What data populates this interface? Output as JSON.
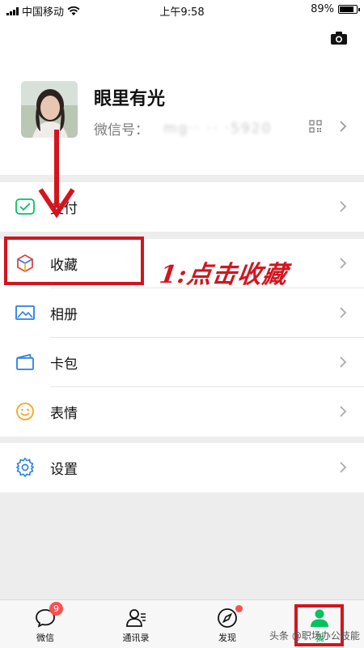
{
  "status_bar": {
    "carrier": "中国移动",
    "time": "上午9:58",
    "battery": "89%",
    "battery_level": 0.89
  },
  "profile": {
    "name": "眼里有光",
    "wechat_id_label": "微信号：",
    "wechat_id_value": "mg·· ·· ·5920"
  },
  "menu_groups": [
    {
      "items": [
        {
          "label": "支付",
          "icon": "pay-icon"
        }
      ]
    },
    {
      "items": [
        {
          "label": "收藏",
          "icon": "favorites-icon"
        },
        {
          "label": "相册",
          "icon": "album-icon"
        },
        {
          "label": "卡包",
          "icon": "card-wallet-icon"
        },
        {
          "label": "表情",
          "icon": "sticker-icon"
        }
      ]
    },
    {
      "items": [
        {
          "label": "设置",
          "icon": "settings-icon"
        }
      ]
    }
  ],
  "tab_bar": {
    "tabs": [
      {
        "label": "微信",
        "icon": "chat-bubble-icon",
        "badge": "9"
      },
      {
        "label": "通讯录",
        "icon": "contacts-icon"
      },
      {
        "label": "发现",
        "icon": "compass-icon"
      },
      {
        "label": "我",
        "icon": "person-icon",
        "active": true
      }
    ]
  },
  "annotation": {
    "text": "1:点击收藏"
  },
  "watermark": {
    "text": "头条 @职场办公技能"
  },
  "colors": {
    "accent_green": "#07c160",
    "badge_red": "#fa5151",
    "annotation_red": "#d4141d"
  }
}
